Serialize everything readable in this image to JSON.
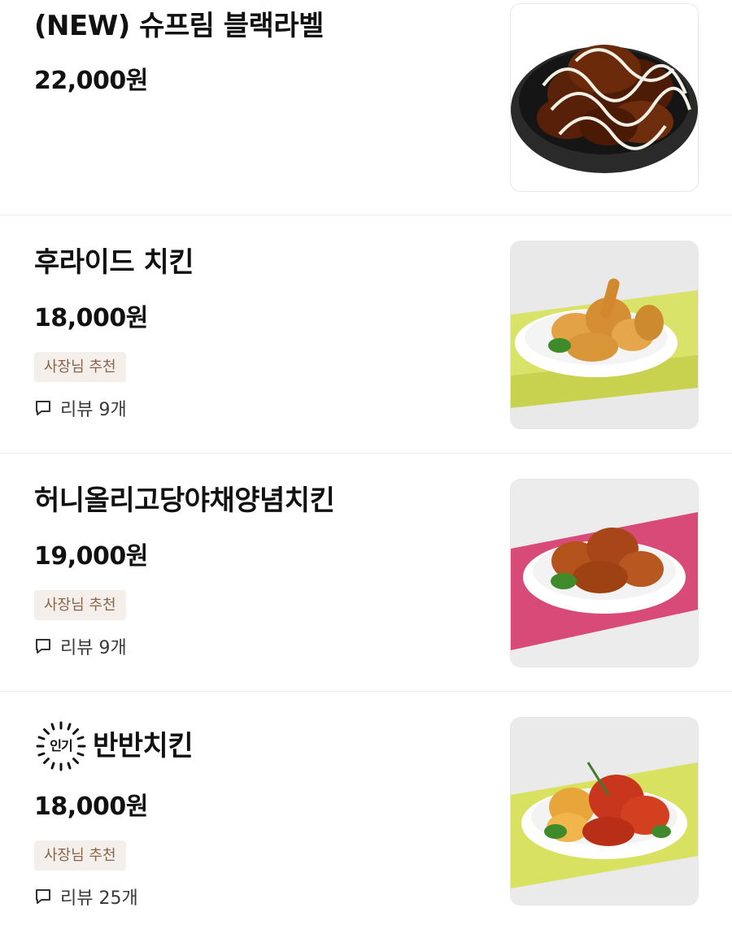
{
  "menu_items": [
    {
      "name": "(NEW) 슈프림 블랙라벨",
      "price": "22,000원",
      "image_icon": "chicken-dish-image"
    },
    {
      "name": "후라이드 치킨",
      "price": "18,000원",
      "badge": "사장님 추천",
      "review": "리뷰 9개",
      "image_icon": "chicken-dish-image"
    },
    {
      "name": "허니올리고당야채양념치킨",
      "price": "19,000원",
      "badge": "사장님 추천",
      "review": "리뷰 9개",
      "image_icon": "chicken-dish-image"
    },
    {
      "name": "반반치킨",
      "popular_label": "인기",
      "price": "18,000원",
      "badge": "사장님 추천",
      "review": "리뷰 25개",
      "image_icon": "chicken-dish-image"
    }
  ],
  "colors": {
    "badge_bg": "#f4efea",
    "badge_text": "#8a6448",
    "divider": "#ececec"
  }
}
